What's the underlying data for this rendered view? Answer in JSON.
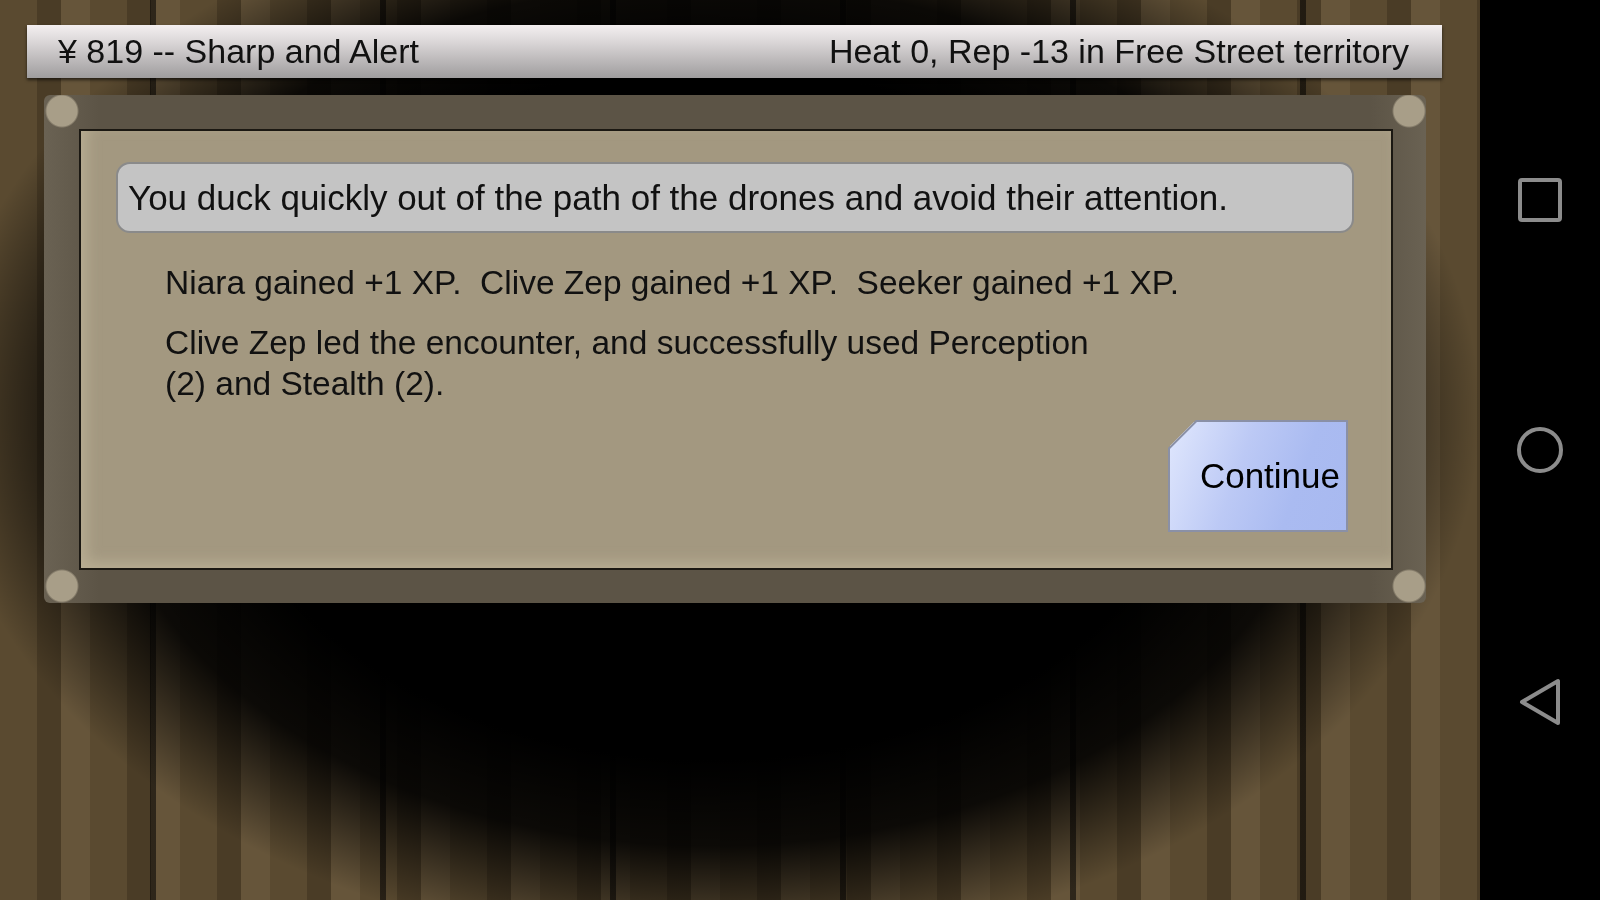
{
  "status_bar": {
    "left": "¥ 819 -- Sharp and Alert",
    "right": "Heat 0, Rep -13 in Free Street territory"
  },
  "dialog": {
    "message": "You duck quickly out of the path of the drones and avoid their attention.",
    "paragraphs": [
      {
        "kind": "gains",
        "text": "Niara gained +1 XP.  Clive Zep gained +1 XP.  Seeker gained +1 XP."
      },
      {
        "kind": "summary",
        "text": "Clive Zep led the encounter, and successfully used Perception (2) and Stealth (2)."
      }
    ],
    "button": "Continue"
  }
}
